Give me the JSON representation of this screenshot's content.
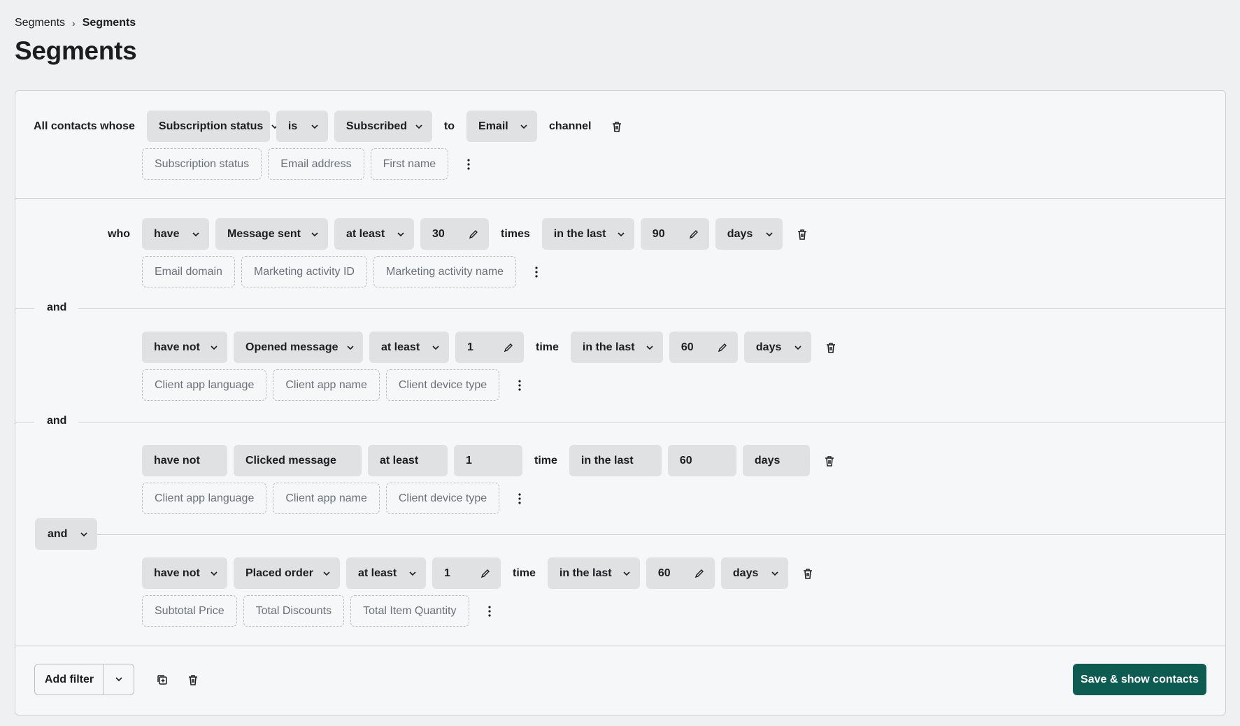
{
  "breadcrumb": {
    "root": "Segments",
    "separator": "›",
    "current": "Segments"
  },
  "page_title": "Segments",
  "first_rule": {
    "lead": "All contacts whose",
    "field": "Subscription status",
    "operator": "is",
    "value": "Subscribed",
    "to": "to",
    "channel": "Email",
    "channel_word": "channel",
    "chips": [
      "Subscription status",
      "Email address",
      "First name"
    ]
  },
  "conditions": [
    {
      "lead": "who",
      "verb": "have",
      "event": "Message sent",
      "qualifier": "at least",
      "count": "30",
      "unit": "times",
      "window": "in the last",
      "days": "90",
      "period": "days",
      "chips": [
        "Email domain",
        "Marketing activity ID",
        "Marketing activity name"
      ]
    },
    {
      "verb": "have not",
      "event": "Opened message",
      "qualifier": "at least",
      "count": "1",
      "unit": "time",
      "window": "in the last",
      "days": "60",
      "period": "days",
      "chips": [
        "Client app language",
        "Client app name",
        "Client device type"
      ]
    },
    {
      "verb": "have not",
      "event": "Clicked message",
      "qualifier": "at least",
      "count": "1",
      "unit": "time",
      "window": "in the last",
      "days": "60",
      "period": "days",
      "chips": [
        "Client app language",
        "Client app name",
        "Client device type"
      ]
    },
    {
      "verb": "have not",
      "event": "Placed order",
      "qualifier": "at least",
      "count": "1",
      "unit": "time",
      "window": "in the last",
      "days": "60",
      "period": "days",
      "chips": [
        "Subtotal Price",
        "Total Discounts",
        "Total Item Quantity"
      ]
    }
  ],
  "connectors": [
    "and",
    "and",
    "and"
  ],
  "footer": {
    "add_filter": "Add filter",
    "save": "Save & show contacts"
  },
  "colors": {
    "primary": "#0e5b52",
    "pill": "#dfe1e3",
    "page_bg": "#eff0f1"
  },
  "icons": [
    "chevron-down-icon",
    "pencil-icon",
    "trash-icon",
    "kebab-icon",
    "duplicate-icon"
  ]
}
